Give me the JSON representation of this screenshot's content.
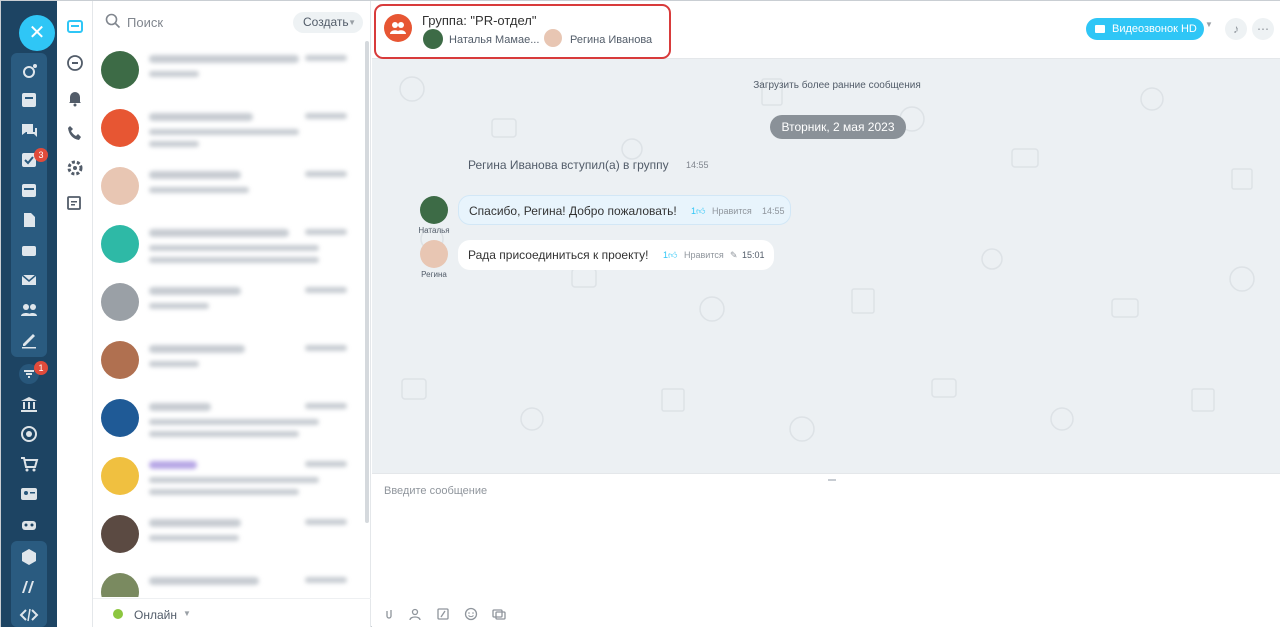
{
  "recent": {
    "search_placeholder": "Поиск",
    "create_label": "Создать",
    "status_label": "Онлайн"
  },
  "chat": {
    "title": "Группа: \"PR-отдел\"",
    "members": [
      "Наталья Мамае...",
      "Регина Иванова"
    ],
    "video_label": "Видеозвонок HD",
    "load_earlier": "Загрузить более ранние сообщения",
    "date_pill": "Вторник, 2 мая 2023",
    "system_message": "Регина Иванова вступил(а) в группу",
    "system_time": "14:55",
    "messages": [
      {
        "author": "Наталья",
        "text": "Спасибо, Регина! Добро пожаловать!",
        "likes": "1",
        "like_label": "Нравится",
        "time": "14:55"
      },
      {
        "author": "Регина",
        "text": "Рада присоединиться к проекту!",
        "likes": "1",
        "like_label": "Нравится",
        "time": "15:01"
      }
    ],
    "input_placeholder": "Введите сообщение"
  },
  "badges": {
    "tasks": "3",
    "notifications": "1"
  },
  "colors": {
    "rail": "#1d4463",
    "accent": "#2fc6f6",
    "highlight": "#d83b3b",
    "group_avatar": "#e75633"
  }
}
